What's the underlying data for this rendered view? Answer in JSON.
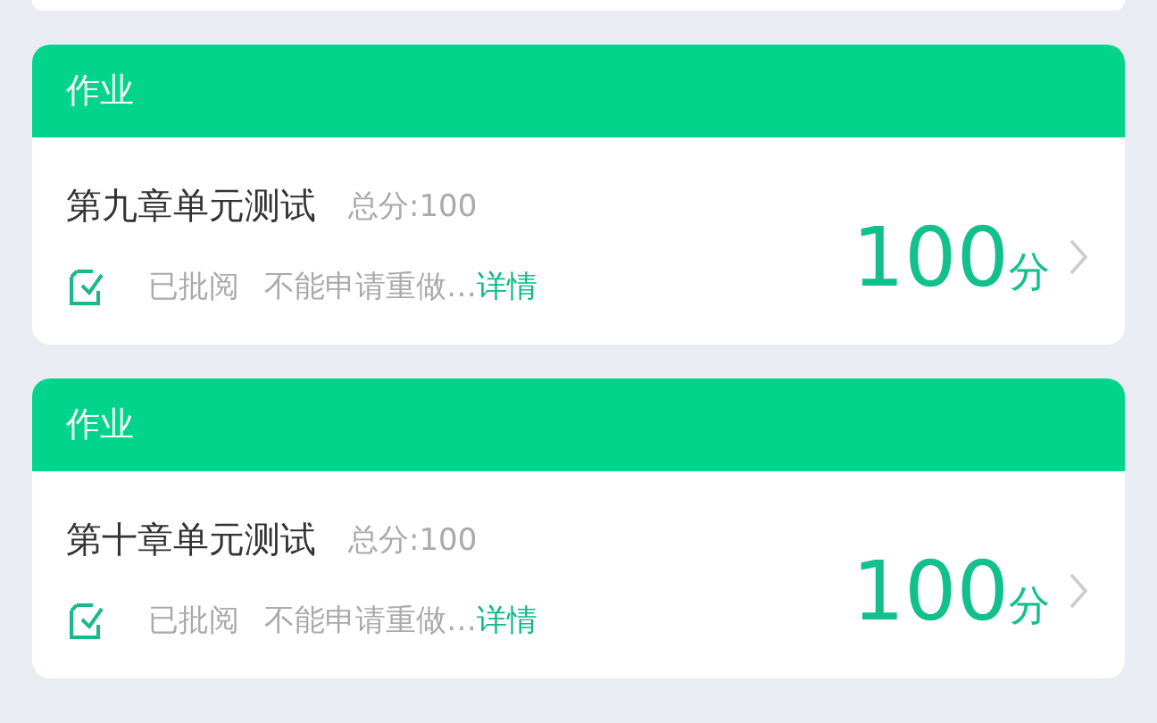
{
  "assignments": [
    {
      "header": "作业",
      "title": "第九章单元测试",
      "total": "总分:100",
      "status": "已批阅",
      "note": "不能申请重做…",
      "link": "详情",
      "score": "100",
      "unit": "分"
    },
    {
      "header": "作业",
      "title": "第十章单元测试",
      "total": "总分:100",
      "status": "已批阅",
      "note": "不能申请重做…",
      "link": "详情",
      "score": "100",
      "unit": "分"
    }
  ]
}
